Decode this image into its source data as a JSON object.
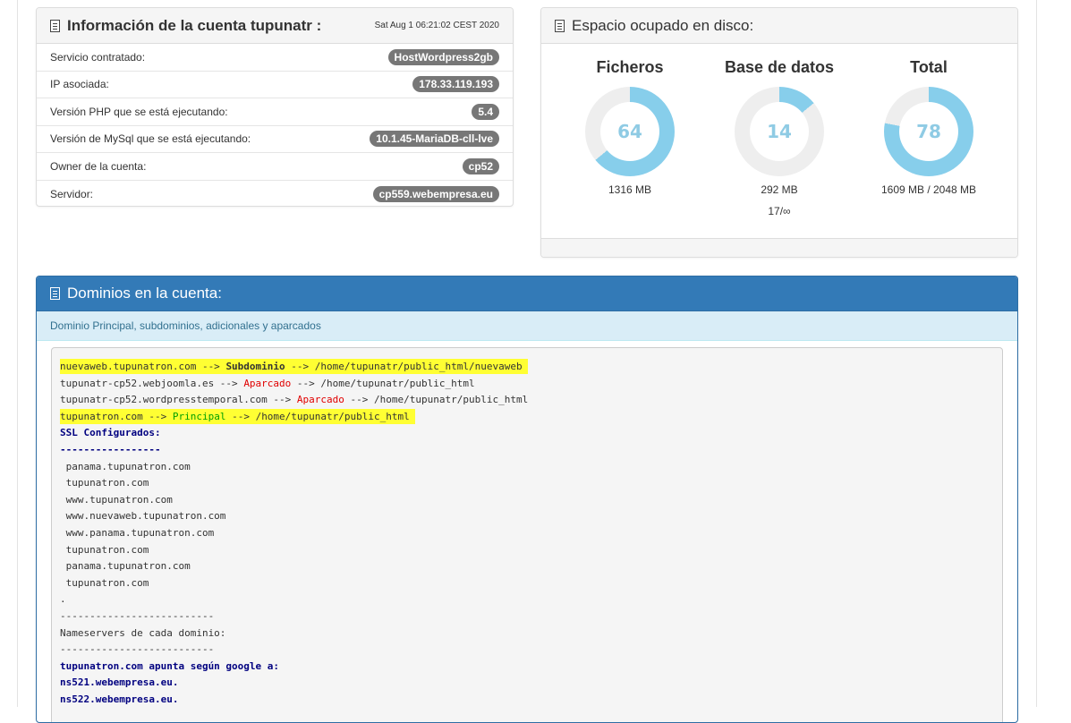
{
  "account_panel": {
    "title": "Información de la cuenta tupunatr :",
    "date": "Sat Aug 1 06:21:02 CEST 2020",
    "rows": [
      {
        "label": "Servicio contratado:",
        "value": "HostWordpress2gb"
      },
      {
        "label": "IP asociada:",
        "value": "178.33.119.193"
      },
      {
        "label": "Versión PHP que se está ejecutando:",
        "value": "5.4"
      },
      {
        "label": "Versión de MySql que se está ejecutando:",
        "value": "10.1.45-MariaDB-cll-lve"
      },
      {
        "label": "Owner de la cuenta:",
        "value": "cp52"
      },
      {
        "label": "Servidor:",
        "value": "cp559.webempresa.eu"
      }
    ]
  },
  "disk_panel": {
    "title": "Espacio ocupado en disco:",
    "gauges": [
      {
        "title": "Ficheros",
        "value": "64",
        "percent": 64,
        "sub": "1316 MB",
        "extra": ""
      },
      {
        "title": "Base de datos",
        "value": "14",
        "percent": 14,
        "sub": "292 MB",
        "extra": "17/∞"
      },
      {
        "title": "Total",
        "value": "78",
        "percent": 78,
        "sub": "1609 MB / 2048 MB",
        "extra": ""
      }
    ],
    "colors": {
      "fill": "#87ceeb",
      "track": "#eeeeee"
    }
  },
  "domains_panel": {
    "title": "Dominios en la cuenta:",
    "subtitle": "Dominio Principal, subdominios, adicionales y aparcados",
    "lines": {
      "l1a": "nuevaweb.tupunatron.com --> ",
      "l1b": "Subdominio",
      "l1c": " --> /home/tupunatr/public_html/nuevaweb",
      "l2a": "tupunatr-cp52.webjoomla.es --> ",
      "l2b": "Aparcado",
      "l2c": " --> /home/tupunatr/public_html",
      "l3a": "tupunatr-cp52.wordpresstemporal.com --> ",
      "l3b": "Aparcado",
      "l3c": " --> /home/tupunatr/public_html",
      "l4a": "tupunatron.com --> ",
      "l4b": "Principal",
      "l4c": " --> /home/tupunatr/public_html",
      "ssl_header": "SSL Configurados:",
      "sep1": "-----------------",
      "ssl": [
        " panama.tupunatron.com",
        " tupunatron.com",
        " www.tupunatron.com",
        " www.nuevaweb.tupunatron.com",
        " www.panama.tupunatron.com",
        " tupunatron.com",
        " panama.tupunatron.com",
        " tupunatron.com"
      ],
      "dot": ".",
      "sep2": "--------------------------",
      "ns_header": "Nameservers de cada dominio:",
      "sep3": "--------------------------",
      "ns_domain": "tupunatron.com apunta según google a:",
      "ns1": "ns521.webempresa.eu.",
      "ns2": "ns522.webempresa.eu."
    }
  }
}
